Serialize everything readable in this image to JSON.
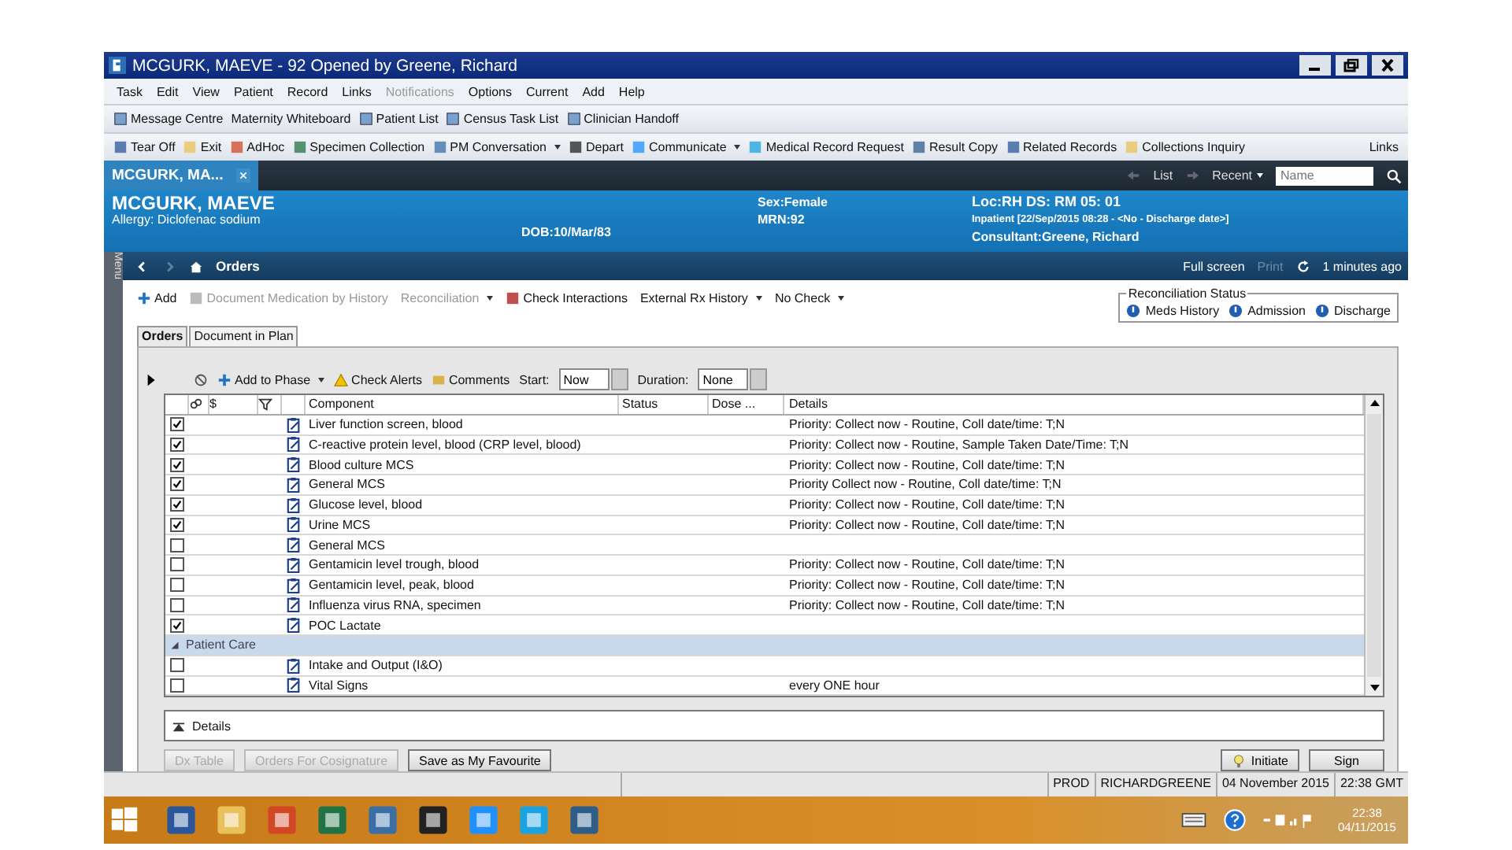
{
  "window": {
    "title": "MCGURK, MAEVE - 92 Opened by  Greene, Richard"
  },
  "menu": [
    {
      "label": "Task",
      "disabled": false
    },
    {
      "label": "Edit",
      "disabled": false
    },
    {
      "label": "View",
      "disabled": false
    },
    {
      "label": "Patient",
      "disabled": false
    },
    {
      "label": "Record",
      "disabled": false
    },
    {
      "label": "Links",
      "disabled": false
    },
    {
      "label": "Notifications",
      "disabled": true
    },
    {
      "label": "Options",
      "disabled": false
    },
    {
      "label": "Current",
      "disabled": false
    },
    {
      "label": "Add",
      "disabled": false
    },
    {
      "label": "Help",
      "disabled": false
    }
  ],
  "toolbar_1": [
    {
      "label": "Message Centre",
      "kind": "icon"
    },
    {
      "label": "Maternity Whiteboard",
      "kind": "plain"
    },
    {
      "label": "Patient List",
      "kind": "icon"
    },
    {
      "label": "Census Task List",
      "kind": "icon"
    },
    {
      "label": "Clinician Handoff",
      "kind": "icon"
    }
  ],
  "toolbar_2": [
    {
      "label": "Tear Off",
      "kind": "icon"
    },
    {
      "label": "Exit",
      "kind": "icon"
    },
    {
      "label": "AdHoc",
      "kind": "icon"
    },
    {
      "label": "Specimen Collection",
      "kind": "icon"
    },
    {
      "label": "PM Conversation",
      "kind": "dropdown"
    },
    {
      "label": "Depart",
      "kind": "icon"
    },
    {
      "label": "Communicate",
      "kind": "dropdown"
    },
    {
      "label": "Medical Record Request",
      "kind": "icon"
    },
    {
      "label": "Result Copy",
      "kind": "icon"
    },
    {
      "label": "Related Records",
      "kind": "icon"
    },
    {
      "label": "Collections Inquiry",
      "kind": "icon"
    }
  ],
  "toolbar_2_right": {
    "links": "Links"
  },
  "patient_tab": {
    "label": "MCGURK, MA..."
  },
  "patient_nav": {
    "list": "List",
    "recent": "Recent",
    "search": {
      "placeholder": "Name"
    }
  },
  "banner": {
    "name": "MCGURK, MAEVE",
    "allergy": "Allergy: Diclofenac sodium",
    "dob": "DOB:10/Mar/83",
    "sex": "Sex:Female",
    "mrn": "MRN:92",
    "location": "Loc:RH DS: RM 05: 01",
    "encounter": "Inpatient [22/Sep/2015 08:28 - <No - Discharge date>]",
    "consultant": "Consultant:Greene, Richard"
  },
  "nav_bar": {
    "side_tab": "Menu",
    "page": "Orders",
    "full_screen": "Full screen",
    "print": "Print",
    "refreshed": "1 minutes ago"
  },
  "actions": [
    {
      "label": "Add",
      "kind": "add",
      "disabled": false
    },
    {
      "label": "Document Medication by History",
      "kind": "icon",
      "disabled": true
    },
    {
      "label": "Reconciliation",
      "kind": "dropdown",
      "disabled": true
    },
    {
      "label": "Check Interactions",
      "kind": "icon",
      "disabled": false
    },
    {
      "label": "External Rx History",
      "kind": "dropdown",
      "disabled": false
    },
    {
      "label": "No Check",
      "kind": "dropdown",
      "disabled": false
    }
  ],
  "reconciliation_status": {
    "title": "Reconciliation Status",
    "items": [
      "Meds History",
      "Admission",
      "Discharge"
    ]
  },
  "tabs": [
    {
      "label": "Orders",
      "selected": true
    },
    {
      "label": "Document in Plan",
      "selected": false
    }
  ],
  "order_toolbar": {
    "add_to_phase": "Add to Phase",
    "check_alerts": "Check Alerts",
    "comments": "Comments",
    "start_label": "Start:",
    "start_value": "Now",
    "duration_label": "Duration:",
    "duration_value": "None"
  },
  "table": {
    "columns": [
      "$",
      "Component",
      "Status",
      "Dose ...",
      "Details"
    ],
    "rows": [
      {
        "kind": "order",
        "checked": true,
        "component": "Liver function screen, blood",
        "details": "Priority: Collect now - Routine, Coll date/time: T;N"
      },
      {
        "kind": "order",
        "checked": true,
        "component": "C-reactive protein level, blood (CRP level, blood)",
        "details": "Priority: Collect now - Routine, Sample Taken Date/Time: T;N"
      },
      {
        "kind": "order",
        "checked": true,
        "component": "Blood culture MCS",
        "details": "Priority: Collect now - Routine, Coll date/time: T;N"
      },
      {
        "kind": "order",
        "checked": true,
        "component": "General MCS",
        "details": "Priority Collect now - Routine, Coll date/time: T;N"
      },
      {
        "kind": "order",
        "checked": true,
        "component": "Glucose level, blood",
        "details": "Priority: Collect now - Routine, Coll date/time: T;N"
      },
      {
        "kind": "order",
        "checked": true,
        "component": "Urine MCS",
        "details": "Priority: Collect now - Routine, Coll date/time: T;N"
      },
      {
        "kind": "order",
        "checked": false,
        "component": "General MCS",
        "details": ""
      },
      {
        "kind": "order",
        "checked": false,
        "component": "Gentamicin level trough, blood",
        "details": "Priority: Collect now - Routine, Coll date/time: T;N"
      },
      {
        "kind": "order",
        "checked": false,
        "component": "Gentamicin level, peak, blood",
        "details": "Priority: Collect now - Routine, Coll date/time: T;N"
      },
      {
        "kind": "order",
        "checked": false,
        "component": "Influenza virus RNA, specimen",
        "details": "Priority: Collect now - Routine, Coll date/time: T;N"
      },
      {
        "kind": "order",
        "checked": true,
        "component": "POC Lactate",
        "details": ""
      },
      {
        "kind": "group",
        "label": "Patient Care",
        "expanded": true
      },
      {
        "kind": "order",
        "checked": false,
        "component": "Intake and Output (I&O)",
        "details": ""
      },
      {
        "kind": "order",
        "checked": false,
        "component": "Vital Signs",
        "details": "every ONE hour"
      }
    ]
  },
  "details_panel": {
    "label": "Details"
  },
  "buttons_left": [
    {
      "label": "Dx Table",
      "disabled": true
    },
    {
      "label": "Orders For Cosignature",
      "disabled": true
    },
    {
      "label": "Save as My Favourite",
      "disabled": false
    }
  ],
  "buttons_right": [
    {
      "label": "Initiate",
      "kind": "icon"
    },
    {
      "label": "Sign",
      "kind": "plain"
    }
  ],
  "status_bar": [
    "PROD",
    "RICHARDGREENE",
    "04 November 2015",
    "22:38 GMT"
  ],
  "taskbar": {
    "time": "22:38",
    "date": "04/11/2015"
  }
}
